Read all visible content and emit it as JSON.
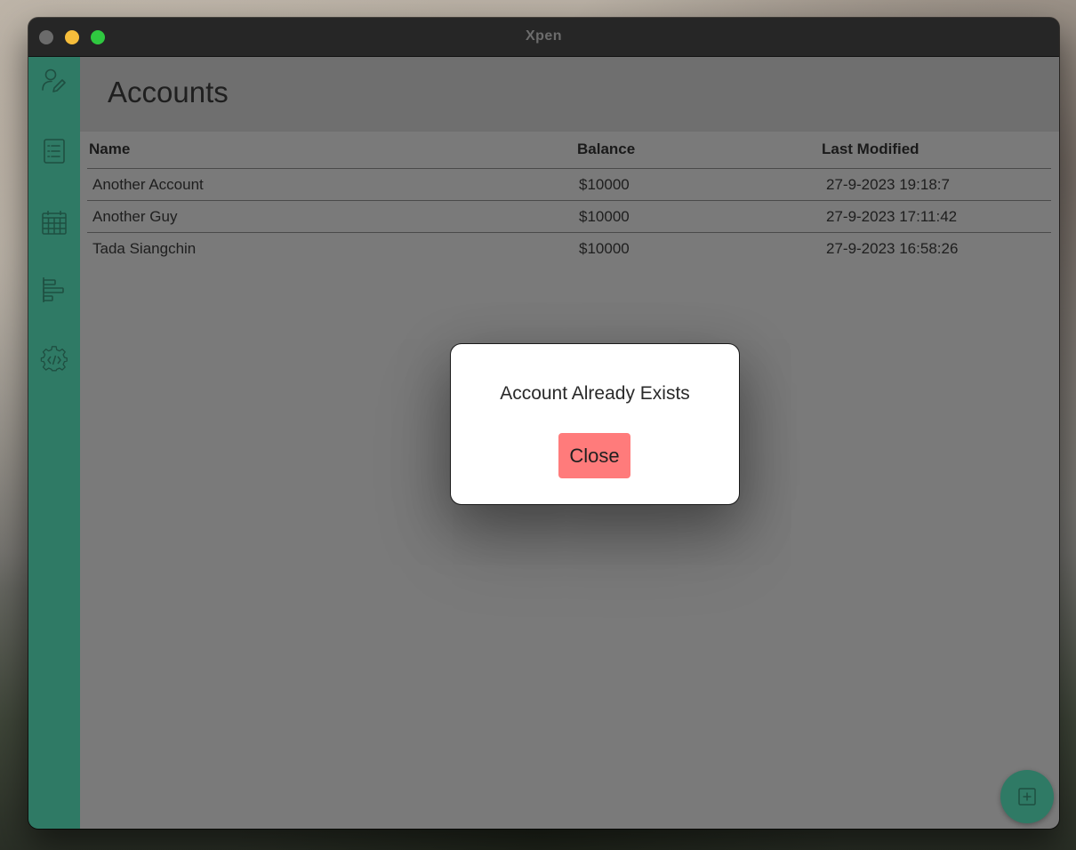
{
  "window": {
    "title": "Xpen"
  },
  "sidebar": {
    "items": [
      {
        "icon": "user-edit-icon"
      },
      {
        "icon": "list-icon"
      },
      {
        "icon": "calendar-icon"
      },
      {
        "icon": "bar-chart-icon"
      },
      {
        "icon": "settings-code-icon"
      }
    ]
  },
  "page": {
    "title": "Accounts"
  },
  "table": {
    "columns": [
      "Name",
      "Balance",
      "Last Modified"
    ],
    "rows": [
      {
        "name": "Another Account",
        "balance": "$10000",
        "last_modified": "27-9-2023 19:18:7"
      },
      {
        "name": "Another Guy",
        "balance": "$10000",
        "last_modified": "27-9-2023 17:11:42"
      },
      {
        "name": "Tada Siangchin",
        "balance": "$10000",
        "last_modified": "27-9-2023 16:58:26"
      }
    ]
  },
  "modal": {
    "message": "Account Already Exists",
    "close_label": "Close"
  },
  "fab": {
    "icon": "add-square-icon"
  },
  "colors": {
    "accent": "#2f7a65",
    "danger": "#ff7b7b"
  }
}
